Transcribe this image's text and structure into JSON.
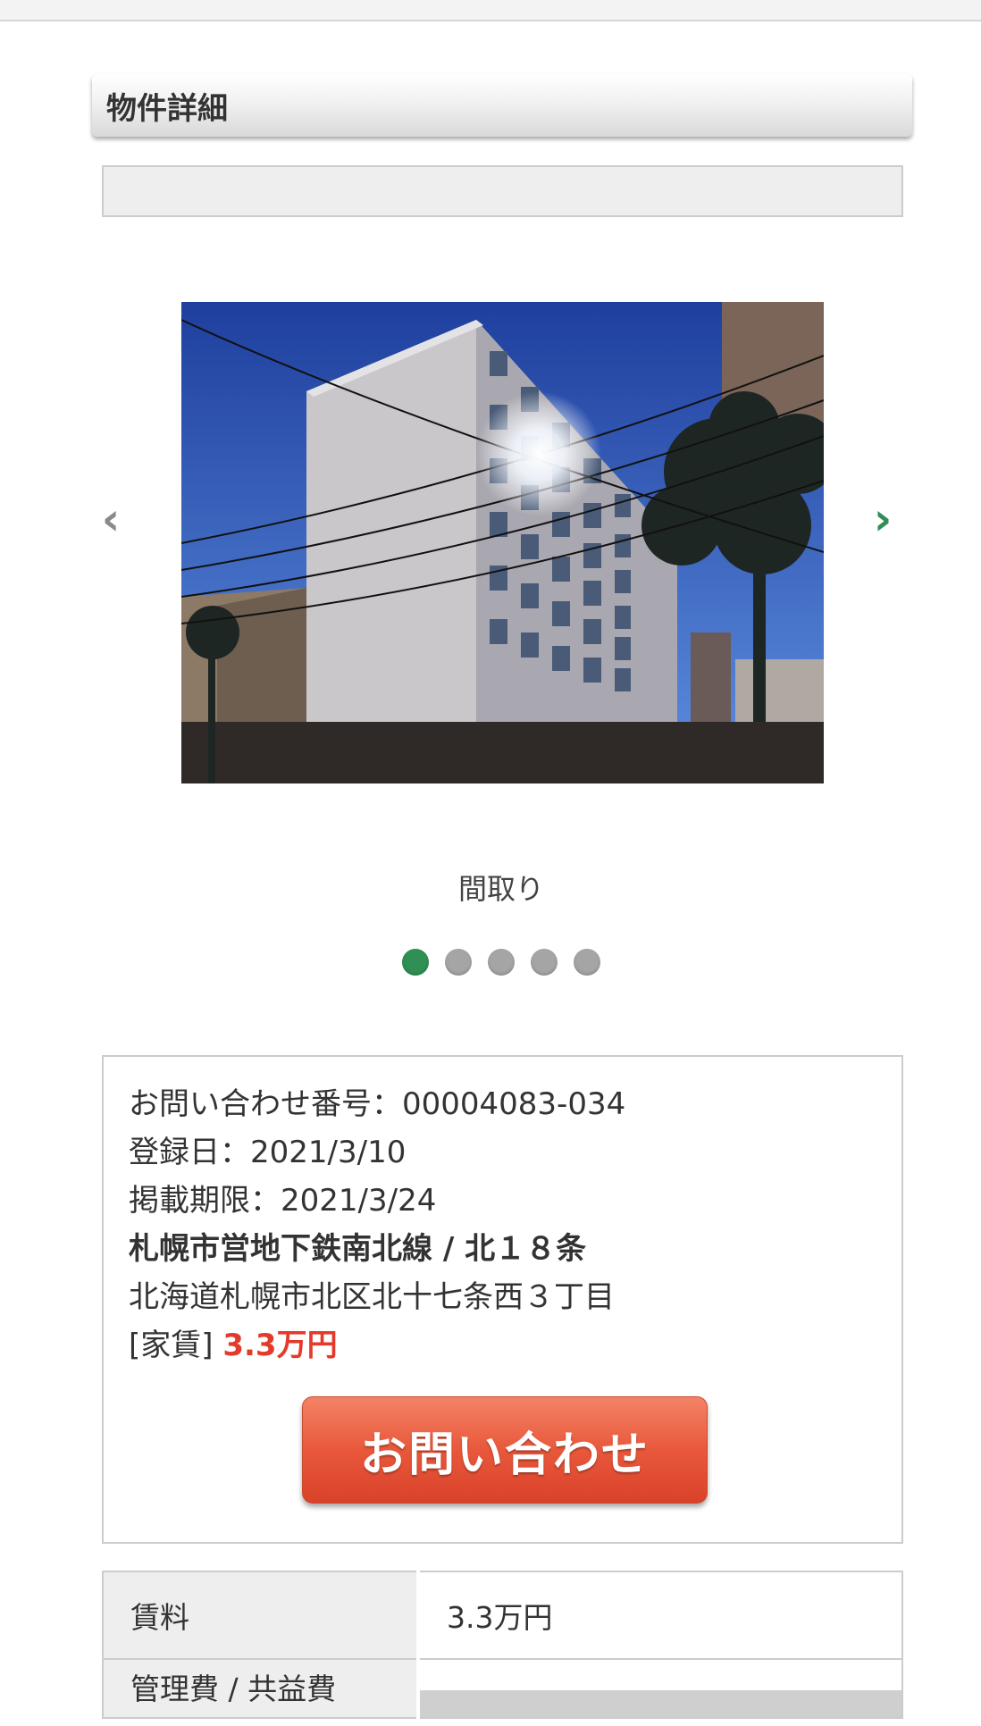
{
  "section_title": "物件詳細",
  "carousel": {
    "caption": "間取り",
    "prev_glyph": "‹",
    "next_glyph": "›",
    "dots": [
      true,
      false,
      false,
      false,
      false
    ]
  },
  "property": {
    "inquiry_number": "お問い合わせ番号：00004083-034",
    "registered": "登録日：2021/3/10",
    "expiry": "掲載期限：2021/3/24",
    "station": "札幌市営地下鉄南北線 / 北１８条",
    "address": "北海道札幌市北区北十七条西３丁目",
    "rent_label": "[家賃] ",
    "rent_value": "3.3万円",
    "contact_button": "お問い合わせ"
  },
  "details": [
    {
      "label": "賃料",
      "value": "3.3万円"
    },
    {
      "label": "管理費 / 共益費",
      "value": ""
    }
  ],
  "colors": {
    "accent_green": "#2f8f55",
    "rent_red": "#e33a2b",
    "button_orange": "#e9583b"
  }
}
